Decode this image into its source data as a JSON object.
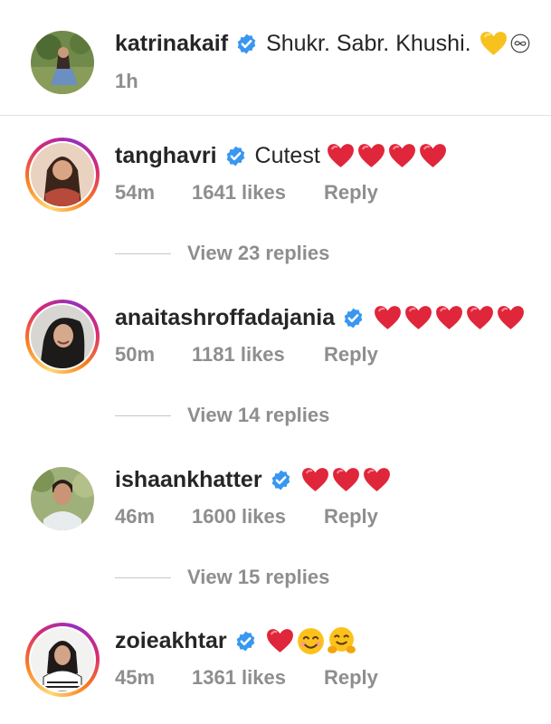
{
  "caption": {
    "username": "katrinakaif",
    "text": "Shukr. Sabr. Khushi.",
    "emojis": [
      "yellow-heart",
      "infinity"
    ],
    "time": "1h"
  },
  "comments": [
    {
      "username": "tanghavri",
      "text": "Cutest",
      "emojis": [
        "red-heart",
        "red-heart",
        "red-heart",
        "red-heart"
      ],
      "time": "54m",
      "likes": "1641 likes",
      "reply": "Reply",
      "view_replies": "View 23 replies"
    },
    {
      "username": "anaitashroffadajania",
      "text": "",
      "emojis": [
        "red-heart",
        "red-heart",
        "red-heart",
        "red-heart",
        "red-heart"
      ],
      "time": "50m",
      "likes": "1181 likes",
      "reply": "Reply",
      "view_replies": "View 14 replies"
    },
    {
      "username": "ishaankhatter",
      "text": "",
      "emojis": [
        "red-heart",
        "red-heart",
        "red-heart"
      ],
      "time": "46m",
      "likes": "1600 likes",
      "reply": "Reply",
      "view_replies": "View 15 replies"
    },
    {
      "username": "zoieakhtar",
      "text": "",
      "emojis": [
        "red-heart",
        "smiling-face",
        "hugging-face"
      ],
      "time": "45m",
      "likes": "1361 likes",
      "reply": "Reply"
    }
  ],
  "colors": {
    "verified": "#3897f0",
    "meta_text": "#8e8e8e",
    "heart": "#e0263a"
  }
}
